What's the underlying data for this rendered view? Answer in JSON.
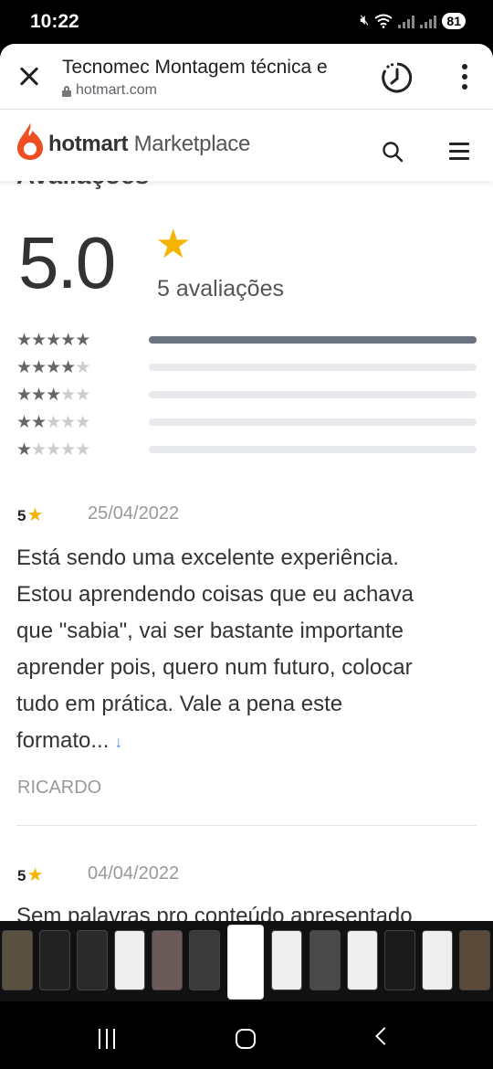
{
  "status": {
    "time": "10:22",
    "battery": "81"
  },
  "browser": {
    "title": "Tecnomec Montagem técnica e",
    "url": "hotmart.com"
  },
  "site": {
    "brand_bold": "hotmart",
    "brand_rest": "Marketplace"
  },
  "rating_summary": {
    "section_title": "Avaliações",
    "score": "5.0",
    "count_label": "5 avaliações",
    "distribution": [
      {
        "stars": 5,
        "fraction": 1.0
      },
      {
        "stars": 4,
        "fraction": 0.0
      },
      {
        "stars": 3,
        "fraction": 0.0
      },
      {
        "stars": 2,
        "fraction": 0.0
      },
      {
        "stars": 1,
        "fraction": 0.0
      }
    ]
  },
  "reviews": [
    {
      "rating": "5",
      "date": "25/04/2022",
      "lines": [
        "Está sendo uma excelente experiência.",
        "Estou aprendendo coisas que eu achava",
        "que \"sabia\", vai ser bastante importante",
        "aprender pois, quero num futuro, colocar",
        "tudo em prática. Vale a pena este",
        "formato..."
      ],
      "author": "RICARDO"
    },
    {
      "rating": "5",
      "date": "04/04/2022",
      "lines": [
        "Sem palavras pro conteúdo apresentado"
      ]
    }
  ],
  "icons": {
    "star": "★",
    "more": "↓",
    "accent": "#f5b400",
    "brand_flame": "#ef4e23"
  }
}
